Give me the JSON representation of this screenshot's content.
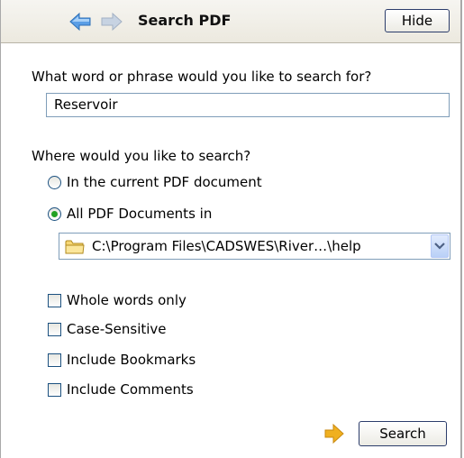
{
  "header": {
    "title": "Search PDF",
    "hide_label": "Hide",
    "back_icon": "back-arrow-icon",
    "forward_icon": "forward-arrow-icon"
  },
  "query": {
    "prompt": "What word or phrase would you like to search for?",
    "value": "Reservoir"
  },
  "scope": {
    "prompt": "Where would you like to search?",
    "options": [
      {
        "label": "In the current PDF document",
        "selected": false
      },
      {
        "label": "All PDF Documents in",
        "selected": true
      }
    ],
    "folder_path": "C:\\Program Files\\CADSWES\\River…\\help"
  },
  "options": [
    {
      "label": "Whole words only",
      "checked": false
    },
    {
      "label": "Case-Sensitive",
      "checked": false
    },
    {
      "label": "Include Bookmarks",
      "checked": false
    },
    {
      "label": "Include Comments",
      "checked": false
    }
  ],
  "footer": {
    "search_label": "Search"
  },
  "colors": {
    "accent_arrow": "#f0b020",
    "nav_blue": "#4a90d9",
    "radio_selected": "#21a121"
  }
}
